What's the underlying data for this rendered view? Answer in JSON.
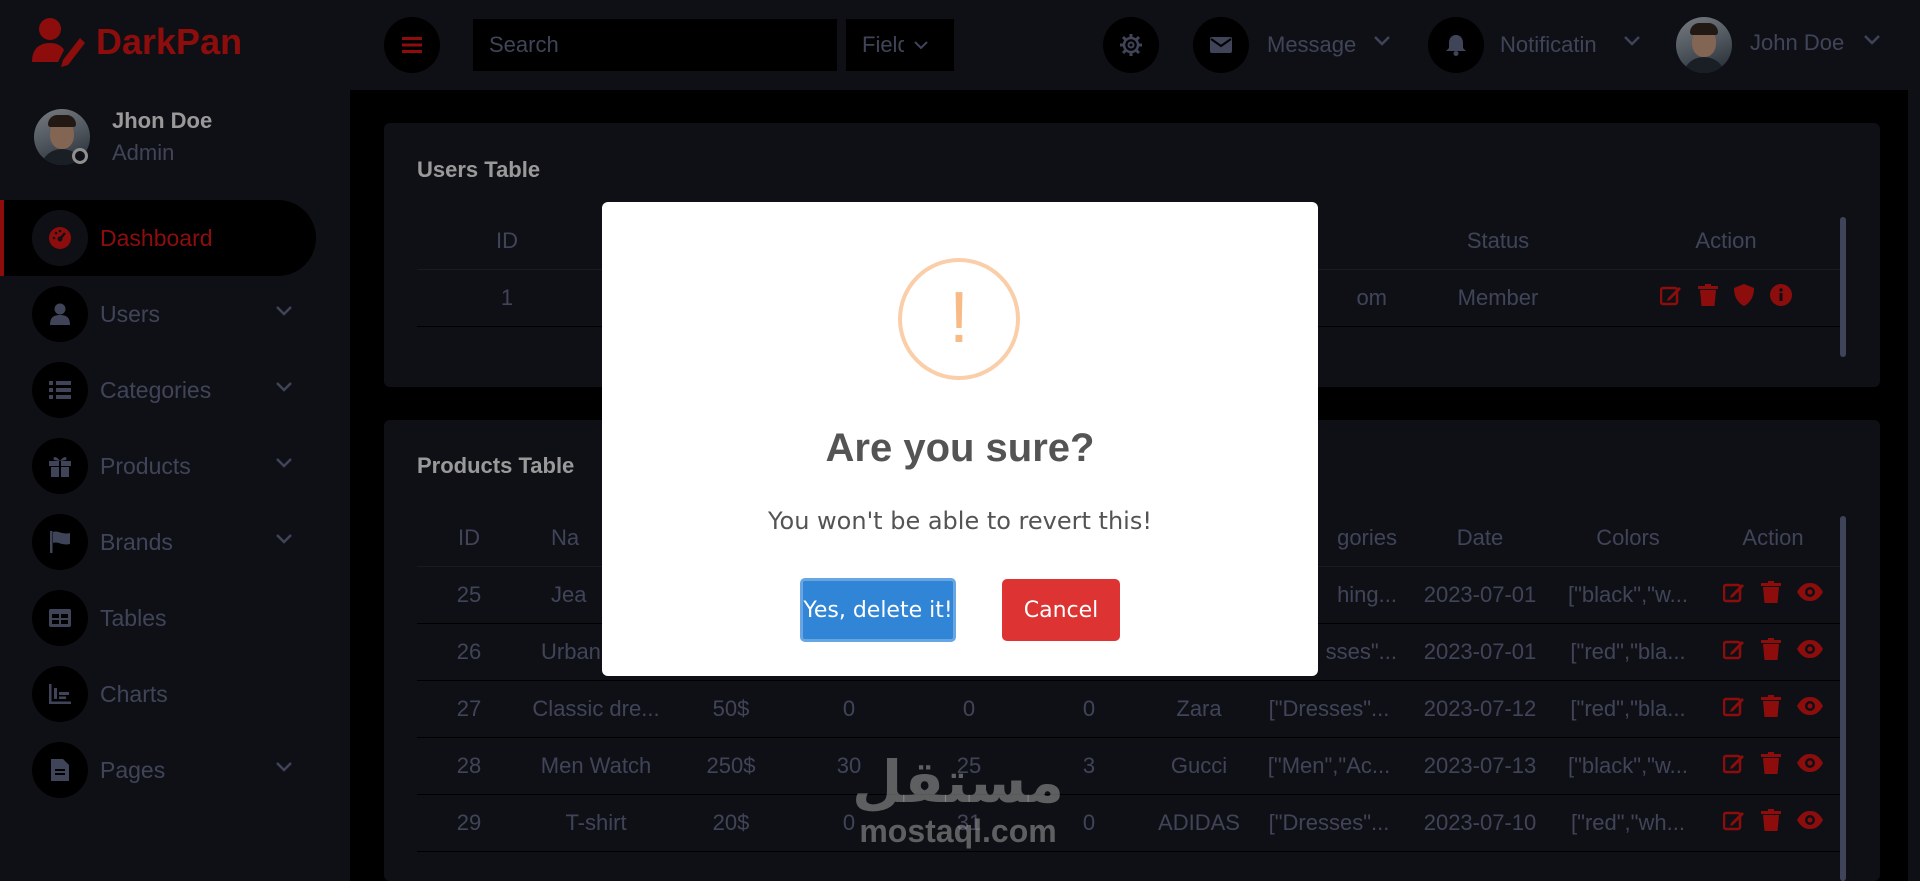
{
  "brand": {
    "name": "DarkPan"
  },
  "profile": {
    "name": "Jhon Doe",
    "role": "Admin"
  },
  "sidebar": {
    "items": [
      {
        "label": "Dashboard",
        "icon": "dashboard-icon",
        "active": true,
        "has_submenu": false
      },
      {
        "label": "Users",
        "icon": "user-icon",
        "active": false,
        "has_submenu": true
      },
      {
        "label": "Categories",
        "icon": "list-icon",
        "active": false,
        "has_submenu": true
      },
      {
        "label": "Products",
        "icon": "gift-icon",
        "active": false,
        "has_submenu": true
      },
      {
        "label": "Brands",
        "icon": "flag-icon",
        "active": false,
        "has_submenu": true
      },
      {
        "label": "Tables",
        "icon": "table-icon",
        "active": false,
        "has_submenu": false
      },
      {
        "label": "Charts",
        "icon": "chart-icon",
        "active": false,
        "has_submenu": false
      },
      {
        "label": "Pages",
        "icon": "page-icon",
        "active": false,
        "has_submenu": true
      }
    ]
  },
  "topbar": {
    "search_placeholder": "Search",
    "field_select": "Field",
    "message_label": "Message",
    "notification_label": "Notificatin",
    "user_name": "John Doe"
  },
  "users_table": {
    "title": "Users Table",
    "columns": [
      "ID",
      "Status",
      "Action"
    ],
    "rows": [
      {
        "id": "1",
        "email_fragment": "om",
        "status": "Member"
      }
    ]
  },
  "products_table": {
    "title": "Products Table",
    "columns": [
      "ID",
      "Na",
      "gories",
      "Date",
      "Colors",
      "Action"
    ],
    "rows": [
      {
        "id": "25",
        "name": "Jea",
        "price": "",
        "c1": "",
        "c2": "",
        "c3": "",
        "brand": "",
        "categories": "hing...",
        "date": "2023-07-01",
        "colors": "[\"black\",\"w..."
      },
      {
        "id": "26",
        "name": "Urban",
        "price": "",
        "c1": "",
        "c2": "",
        "c3": "",
        "brand": "",
        "categories": "sses\"...",
        "date": "2023-07-01",
        "colors": "[\"red\",\"bla..."
      },
      {
        "id": "27",
        "name": "Classic dre...",
        "price": "50$",
        "c1": "0",
        "c2": "0",
        "c3": "0",
        "brand": "Zara",
        "categories": "[\"Dresses\"...",
        "date": "2023-07-12",
        "colors": "[\"red\",\"bla..."
      },
      {
        "id": "28",
        "name": "Men Watch",
        "price": "250$",
        "c1": "30",
        "c2": "25",
        "c3": "3",
        "brand": "Gucci",
        "categories": "[\"Men\",\"Ac...",
        "date": "2023-07-13",
        "colors": "[\"black\",\"w..."
      },
      {
        "id": "29",
        "name": "T-shirt",
        "price": "20$",
        "c1": "0",
        "c2": "31",
        "c3": "0",
        "brand": "ADIDAS",
        "categories": "[\"Dresses\"...",
        "date": "2023-07-10",
        "colors": "[\"red\",\"wh..."
      }
    ]
  },
  "modal": {
    "icon": "!",
    "title": "Are you sure?",
    "text": "You won't be able to revert this!",
    "confirm_label": "Yes, delete it!",
    "cancel_label": "Cancel"
  },
  "watermark": {
    "arabic": "مستقل",
    "latin": "mostaql.com"
  },
  "colors": {
    "accent": "#eb1616",
    "panel": "#191c24",
    "bg": "#000000",
    "muted": "#6c7293",
    "confirm": "#3085d6",
    "cancel": "#dd3333",
    "warning": "#f8bb86"
  }
}
